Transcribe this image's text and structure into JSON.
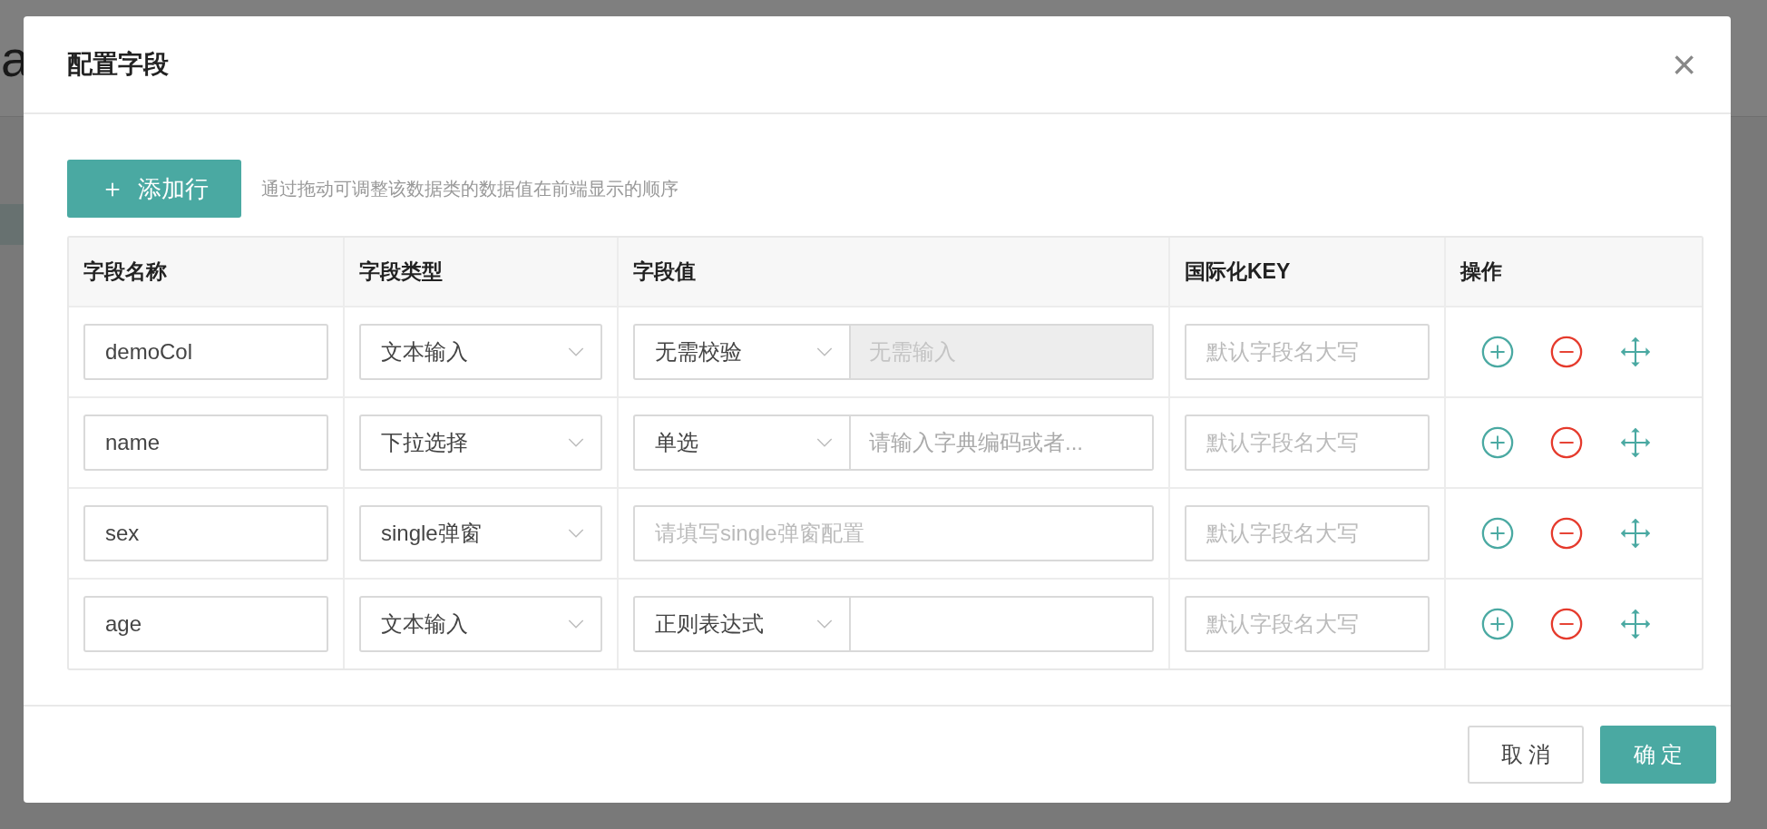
{
  "background": {
    "logo_fragment": "a"
  },
  "dialog": {
    "title": "配置字段",
    "close_icon": "×"
  },
  "toolbar": {
    "add_button": {
      "icon": "＋",
      "label": "添加行"
    },
    "hint": "通过拖动可调整该数据类的数据值在前端显示的顺序"
  },
  "table": {
    "columns": [
      "字段名称",
      "字段类型",
      "字段值",
      "国际化KEY",
      "操作"
    ],
    "rows": [
      {
        "name": "demoCol",
        "type": "文本输入",
        "value": {
          "kind": "select_input",
          "select": "无需校验",
          "input_placeholder": "无需输入",
          "disabled": true
        },
        "i18n_placeholder": "默认字段名大写"
      },
      {
        "name": "name",
        "type": "下拉选择",
        "value": {
          "kind": "select_input",
          "select": "单选",
          "input_placeholder": "请输入字典编码或者...",
          "disabled": false
        },
        "i18n_placeholder": "默认字段名大写"
      },
      {
        "name": "sex",
        "type": "single弹窗",
        "value": {
          "kind": "input",
          "input_placeholder": "请填写single弹窗配置"
        },
        "i18n_placeholder": "默认字段名大写"
      },
      {
        "name": "age",
        "type": "文本输入",
        "value": {
          "kind": "select_input",
          "select": "正则表达式",
          "disabled": false
        },
        "i18n_placeholder": "默认字段名大写"
      }
    ]
  },
  "footer": {
    "buttons": [
      {
        "label": "取 消",
        "kind": "default"
      },
      {
        "label": "确 定",
        "kind": "primary"
      }
    ]
  }
}
